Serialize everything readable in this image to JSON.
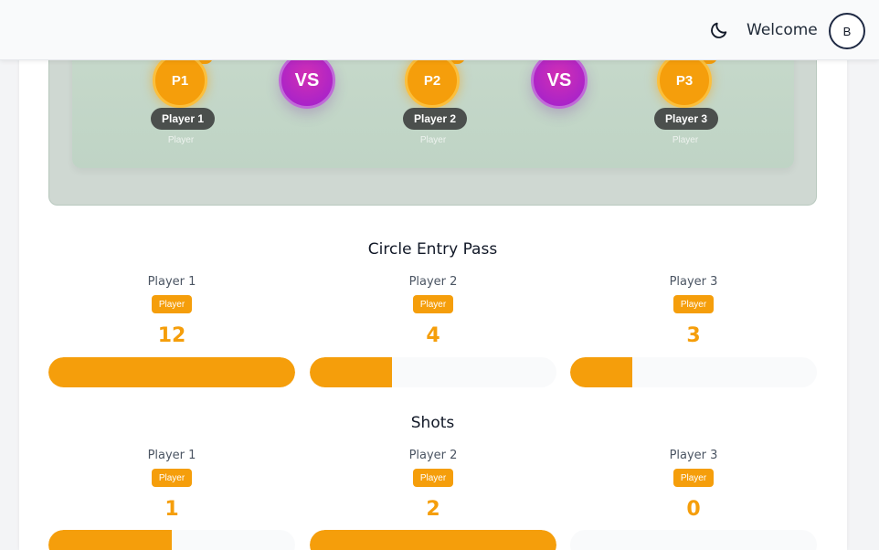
{
  "header": {
    "welcome": "Welcome",
    "avatar_initial": "B"
  },
  "arena": {
    "players": [
      {
        "code": "P1",
        "name": "Player 1",
        "role": "Player"
      },
      {
        "code": "P2",
        "name": "Player 2",
        "role": "Player"
      },
      {
        "code": "P3",
        "name": "Player 3",
        "role": "Player"
      }
    ],
    "vs_label": "VS"
  },
  "stats": [
    {
      "title": "Circle Entry Pass",
      "rows": [
        {
          "name": "Player 1",
          "badge": "Player",
          "value": "12",
          "fill": 1.0
        },
        {
          "name": "Player 2",
          "badge": "Player",
          "value": "4",
          "fill": 0.3333
        },
        {
          "name": "Player 3",
          "badge": "Player",
          "value": "3",
          "fill": 0.25
        }
      ]
    },
    {
      "title": "Shots",
      "rows": [
        {
          "name": "Player 1",
          "badge": "Player",
          "value": "1",
          "fill": 0.5
        },
        {
          "name": "Player 2",
          "badge": "Player",
          "value": "2",
          "fill": 1.0
        },
        {
          "name": "Player 3",
          "badge": "Player",
          "value": "0",
          "fill": 0.0
        }
      ]
    }
  ],
  "colors": {
    "accent": "#f59e0b",
    "vs": "#b526c4",
    "arena": "#cfd8d2"
  }
}
